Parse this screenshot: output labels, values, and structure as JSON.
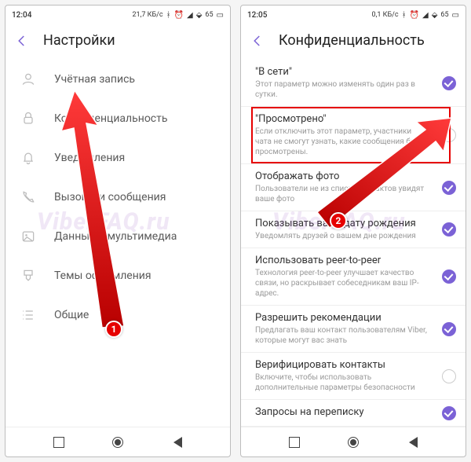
{
  "watermark": "ViberFAQ.ru",
  "left": {
    "status": {
      "time": "12:04",
      "net": "21,7 КБ/с",
      "battery": "65"
    },
    "header": "Настройки",
    "items": [
      {
        "label": "Учётная запись"
      },
      {
        "label": "Конфиденциальность"
      },
      {
        "label": "Уведомления"
      },
      {
        "label": "Вызовы и сообщения"
      },
      {
        "label": "Данные и мультимедиа"
      },
      {
        "label": "Темы оформления"
      },
      {
        "label": "Общие"
      }
    ]
  },
  "right": {
    "status": {
      "time": "12:05",
      "net": "0,1 КБ/с",
      "battery": "65"
    },
    "header": "Конфиденциальность",
    "items": [
      {
        "title": "\"В сети\"",
        "desc": "Этот параметр можно изменять один раз в сутки.",
        "on": true
      },
      {
        "title": "\"Просмотрено\"",
        "desc": "Если отключить этот параметр, участники чата не смогут узнать, какие сообщения были просмотрены.",
        "on": false
      },
      {
        "title": "Отображать фото",
        "desc": "Пользователи не из списка контактов увидят ваше фото",
        "on": true
      },
      {
        "title": "Показывать вашу дату рождения",
        "desc": "Уведомлять друзей о вашем дне рождения",
        "on": true
      },
      {
        "title": "Использовать peer-to-peer",
        "desc": "Технология peer-to-peer улучшает качество связи, но раскрывает собеседникам ваш IP-адрес.",
        "on": true
      },
      {
        "title": "Разрешить рекомендации",
        "desc": "Предлагать ваш контакт пользователям Viber, которые могут вас знать",
        "on": true
      },
      {
        "title": "Верифицировать контакты",
        "desc": "Включите, чтобы использовать дополнительные параметры безопасности",
        "on": false
      },
      {
        "title": "Запросы на переписку",
        "desc": "",
        "on": true
      }
    ]
  },
  "badges": {
    "one": "1",
    "two": "2"
  }
}
